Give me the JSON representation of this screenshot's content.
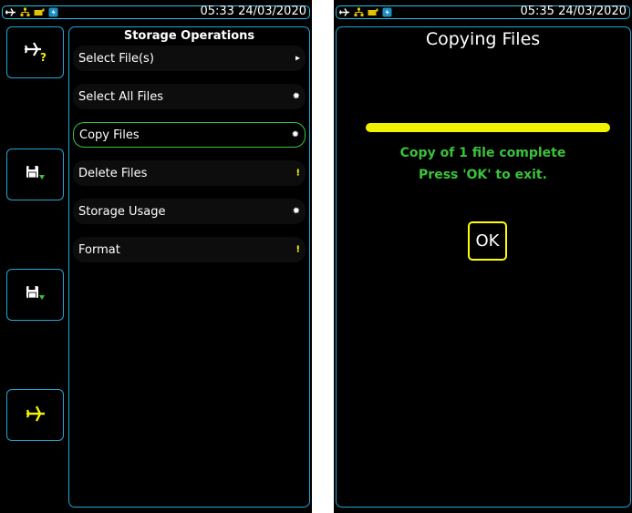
{
  "left_screen": {
    "status": {
      "time": "05:33 24/03/2020"
    },
    "side_buttons": [
      {
        "icon": "plane-question-icon"
      },
      {
        "icon": "floppy-down-icon"
      },
      {
        "icon": "floppy-down-icon"
      },
      {
        "icon": "plane-icon"
      }
    ],
    "menu": {
      "title": "Storage Operations",
      "items": [
        {
          "label": "Select File(s)",
          "marker": "▸",
          "marker_color": "#ffffff"
        },
        {
          "label": "Select All Files",
          "marker": "✹",
          "marker_color": "#ffffff"
        },
        {
          "label": "Copy Files",
          "marker": "✹",
          "marker_color": "#ffffff",
          "selected": true
        },
        {
          "label": "Delete Files",
          "marker": "!",
          "marker_color": "#ffff00"
        },
        {
          "label": "Storage Usage",
          "marker": "✹",
          "marker_color": "#ffffff"
        },
        {
          "label": "Format",
          "marker": "!",
          "marker_color": "#ffff00"
        }
      ]
    }
  },
  "right_screen": {
    "status": {
      "time": "05:35 24/03/2020"
    },
    "title": "Copying Files",
    "progress": 1.0,
    "message_line1": "Copy of 1 file complete",
    "message_line2": "Press 'OK' to exit.",
    "ok_label": "OK"
  },
  "colors": {
    "frame": "#21a7d6",
    "accent_green": "#39c339",
    "accent_yellow": "#ffff00"
  }
}
